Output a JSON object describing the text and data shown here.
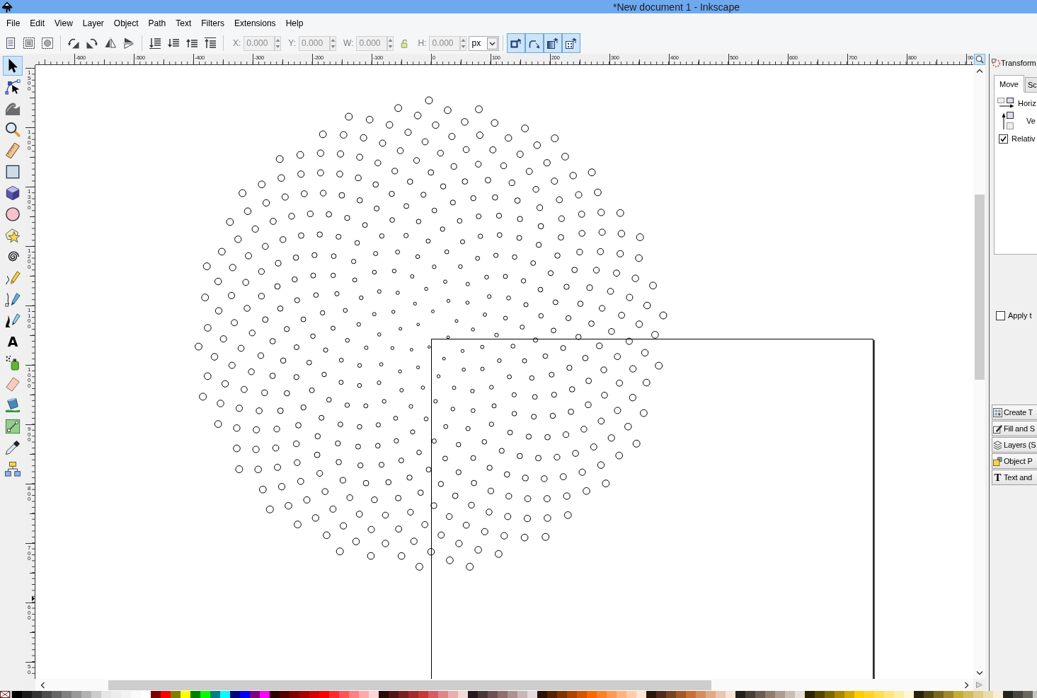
{
  "window": {
    "title": "*New document 1 - Inkscape"
  },
  "menu": [
    "File",
    "Edit",
    "View",
    "Layer",
    "Object",
    "Path",
    "Text",
    "Filters",
    "Extensions",
    "Help"
  ],
  "toolbar": {
    "fields": [
      {
        "label": "X:",
        "value": "0.000",
        "disabled": true
      },
      {
        "label": "Y:",
        "value": "0.000",
        "disabled": true
      },
      {
        "label": "W:",
        "value": "0.000",
        "disabled": true
      },
      {
        "label": "H:",
        "value": "0.000",
        "disabled": true
      }
    ],
    "unit": "px",
    "toggles": [
      {
        "on": true
      },
      {
        "on": true
      },
      {
        "on": true
      },
      {
        "on": true
      }
    ]
  },
  "tools": [
    {
      "selected": true
    },
    {
      "selected": false
    },
    {
      "selected": false
    },
    {
      "selected": false
    },
    {
      "selected": false
    },
    {
      "selected": false
    },
    {
      "selected": false
    },
    {
      "selected": false
    },
    {
      "selected": false
    },
    {
      "selected": false
    },
    {
      "selected": false
    },
    {
      "selected": false
    },
    {
      "selected": false
    },
    {
      "glyph": "A",
      "selected": false
    },
    {
      "selected": false
    },
    {
      "selected": false
    },
    {
      "selected": false
    },
    {
      "selected": false
    },
    {
      "selected": false
    },
    {
      "selected": false
    }
  ],
  "rulers": {
    "horizontal": [
      "-600",
      "-500",
      "-400",
      "-300",
      "-200",
      "-100",
      "0",
      "100",
      "200",
      "300",
      "400",
      "500",
      "600",
      "700",
      "800",
      "90"
    ],
    "vertical": [
      "1500",
      "1400",
      "1300",
      "1200",
      "1100",
      "1000",
      "900",
      "800",
      "700",
      "600",
      "50"
    ]
  },
  "dock": {
    "title": "Transform",
    "tabs": [
      {
        "label": "Move",
        "selected": true
      },
      {
        "label": "Sc",
        "selected": false
      }
    ],
    "rows": [
      "Horiz",
      "Ve"
    ],
    "relative": {
      "label": "Relativ",
      "checked": true
    },
    "apply": {
      "label": "Apply t",
      "checked": false
    },
    "panels": [
      {
        "label": "Create T"
      },
      {
        "label": "Fill and S"
      },
      {
        "label": "Layers (S"
      },
      {
        "label": "Object P"
      },
      {
        "glyph": "T",
        "label": "Text and"
      }
    ]
  },
  "palette": [
    {
      "color": "#000000"
    },
    {
      "color": "#1a1a1a"
    },
    {
      "color": "#333333"
    },
    {
      "color": "#4d4d4d"
    },
    {
      "color": "#666666"
    },
    {
      "color": "#808080"
    },
    {
      "color": "#999999"
    },
    {
      "color": "#b3b3b3"
    },
    {
      "color": "#cccccc"
    },
    {
      "color": "#e6e6e6"
    },
    {
      "color": "#ececec"
    },
    {
      "color": "#f2f2f2"
    },
    {
      "color": "#f9f9f9"
    },
    {
      "color": "#ffffff"
    },
    {
      "color": "#800000"
    },
    {
      "color": "#ff0000"
    },
    {
      "color": "#808000"
    },
    {
      "color": "#ffff00"
    },
    {
      "color": "#008000"
    },
    {
      "color": "#00ff00"
    },
    {
      "color": "#008080"
    },
    {
      "color": "#00ffff"
    },
    {
      "color": "#000080"
    },
    {
      "color": "#0000ff"
    },
    {
      "color": "#800080"
    },
    {
      "color": "#ff00ff"
    },
    {
      "color": "#2b0000"
    },
    {
      "color": "#550000"
    },
    {
      "color": "#800000"
    },
    {
      "color": "#aa0000"
    },
    {
      "color": "#d40000"
    },
    {
      "color": "#ff0000"
    },
    {
      "color": "#ff2a2a"
    },
    {
      "color": "#ff5555"
    },
    {
      "color": "#ff8080"
    },
    {
      "color": "#ffaaaa"
    },
    {
      "color": "#ffd5d5"
    },
    {
      "color": "#280b0b"
    },
    {
      "color": "#501616"
    },
    {
      "color": "#782121"
    },
    {
      "color": "#a02c2c"
    },
    {
      "color": "#c83737"
    },
    {
      "color": "#d35f5f"
    },
    {
      "color": "#de8787"
    },
    {
      "color": "#e9afaf"
    },
    {
      "color": "#f4d7d7"
    },
    {
      "color": "#241c1c"
    },
    {
      "color": "#483737"
    },
    {
      "color": "#6c5353"
    },
    {
      "color": "#916f6f"
    },
    {
      "color": "#ac9393"
    },
    {
      "color": "#c8b7b7"
    },
    {
      "color": "#e3dbdb"
    },
    {
      "color": "#2b1100"
    },
    {
      "color": "#552200"
    },
    {
      "color": "#803300"
    },
    {
      "color": "#aa4400"
    },
    {
      "color": "#d45500"
    },
    {
      "color": "#ff6600"
    },
    {
      "color": "#ff7f2a"
    },
    {
      "color": "#ff9955"
    },
    {
      "color": "#ffb380"
    },
    {
      "color": "#ffccaa"
    },
    {
      "color": "#ffe6d5"
    },
    {
      "color": "#28170b"
    },
    {
      "color": "#502d16"
    },
    {
      "color": "#784421"
    },
    {
      "color": "#a05a2c"
    },
    {
      "color": "#c87137"
    },
    {
      "color": "#d38d5f"
    },
    {
      "color": "#deaa87"
    },
    {
      "color": "#e9c6af"
    },
    {
      "color": "#f4e3d7"
    },
    {
      "color": "#241f1c"
    },
    {
      "color": "#483e37"
    },
    {
      "color": "#6c5d53"
    },
    {
      "color": "#917c6f"
    },
    {
      "color": "#ac9d93"
    },
    {
      "color": "#c8beb7"
    },
    {
      "color": "#e3dedb"
    },
    {
      "color": "#2b2200"
    },
    {
      "color": "#554400"
    },
    {
      "color": "#806600"
    },
    {
      "color": "#aa8800"
    },
    {
      "color": "#d4aa00"
    },
    {
      "color": "#ffcc00"
    },
    {
      "color": "#ffd42a"
    },
    {
      "color": "#ffdd55"
    },
    {
      "color": "#ffe680"
    },
    {
      "color": "#ffeeaa"
    },
    {
      "color": "#fff6d5"
    },
    {
      "color": "#28220b"
    },
    {
      "color": "#504416"
    },
    {
      "color": "#786721"
    },
    {
      "color": "#a0892c"
    },
    {
      "color": "#c8ab37"
    },
    {
      "color": "#d3bc5f"
    },
    {
      "color": "#decd87"
    },
    {
      "color": "#e9ddaf"
    },
    {
      "color": "#f4eed7"
    },
    {
      "color": "#24221c"
    },
    {
      "color": "#48453e"
    },
    {
      "color": "#6c675d"
    }
  ]
}
